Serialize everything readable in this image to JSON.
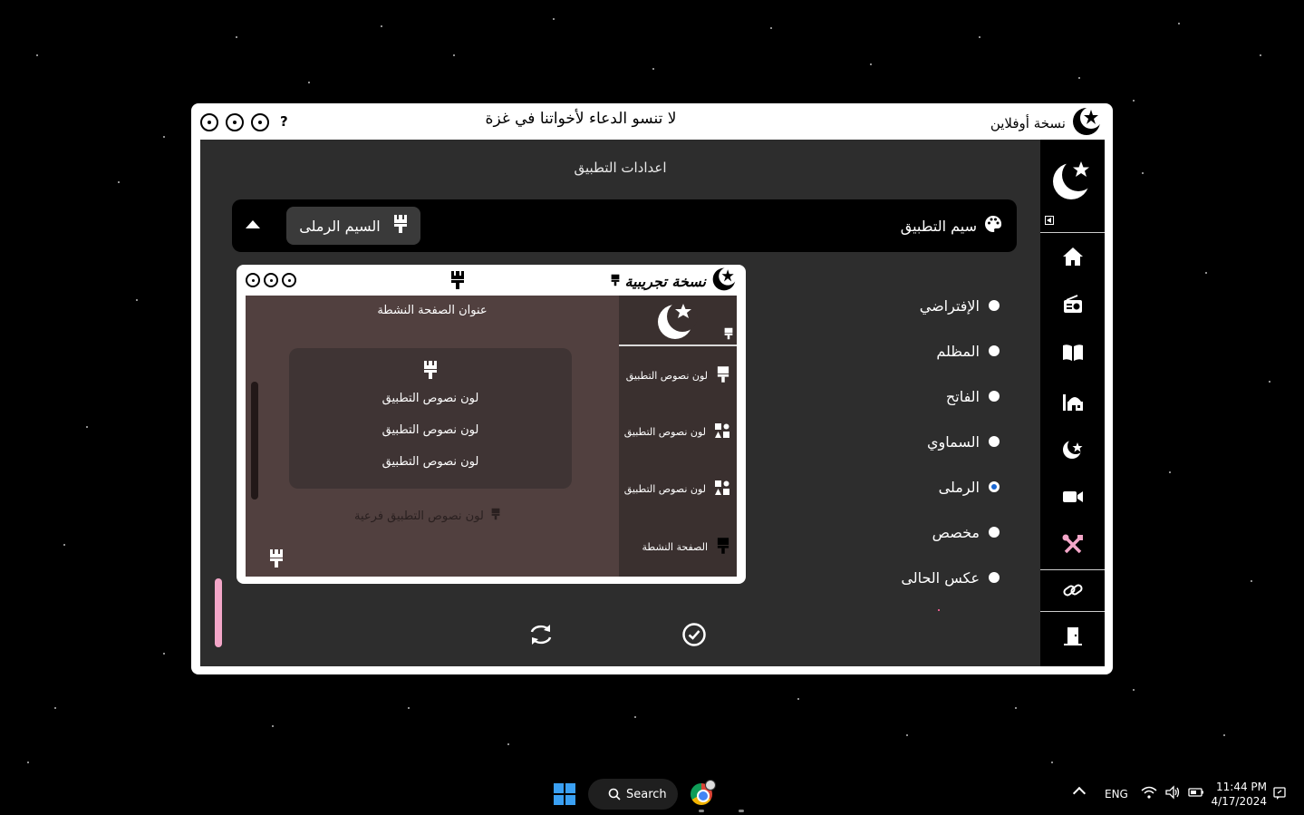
{
  "window": {
    "help_label": "?",
    "title_message": "لا تنسو الدعاء لأخواتنا في غزة",
    "brand_label": "نسخة أوفلاين"
  },
  "settings": {
    "title": "اعدادات التطبيق",
    "theme_label": "سيم التطبيق",
    "selected_theme": "السيم الرملى",
    "options": [
      {
        "label": "الإفتراضي",
        "selected": false
      },
      {
        "label": "المظلم",
        "selected": false
      },
      {
        "label": "الفاتح",
        "selected": false
      },
      {
        "label": "السماوي",
        "selected": false
      },
      {
        "label": "الرملى",
        "selected": true
      },
      {
        "label": "مخصص",
        "selected": false
      },
      {
        "label": "عكس الحالى",
        "selected": false
      }
    ]
  },
  "preview": {
    "brand_label": "نسخة تجريبية",
    "page_title": "عنوان الصفحة النشطة",
    "card_lines": [
      "لون نصوص التطبيق",
      "لون نصوص التطبيق",
      "لون نصوص التطبيق"
    ],
    "sub_text": "لون نصوص التطبيق فرعية",
    "side_items": [
      "لون نصوص التطبيق",
      "لون نصوص التطبيق",
      "لون نصوص التطبيق",
      "الصفحة النشطة"
    ]
  },
  "sidebar": {
    "icons": [
      "home-icon",
      "radio-icon",
      "book-icon",
      "mosque-icon",
      "crescent-icon",
      "video-icon",
      "tools-icon",
      "link-icon",
      "exit-door-icon"
    ],
    "active_color": "#f3a6c8"
  },
  "taskbar": {
    "search_label": "Search",
    "language": "ENG",
    "time": "11:44 PM",
    "date": "4/17/2024"
  },
  "colors": {
    "main_bg": "#2d2d2d",
    "preview_body": "#51403f",
    "preview_side": "#3a302f",
    "accent_pink": "#f3a6c8",
    "radio_selected": "#1a67d2"
  }
}
